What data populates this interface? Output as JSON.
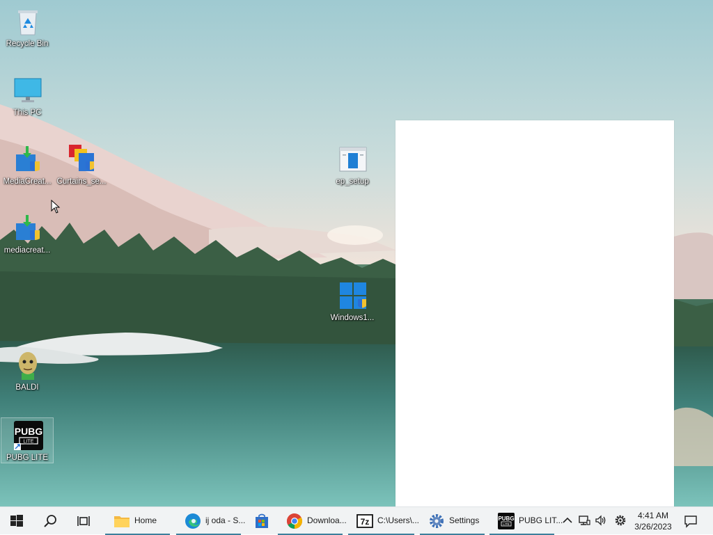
{
  "desktop": {
    "icons": [
      {
        "label": "Recycle Bin",
        "icon": "recycle-bin-icon"
      },
      {
        "label": "This PC",
        "icon": "monitor-icon"
      },
      {
        "label": "MediaCreat...",
        "icon": "media-creation-tool-icon"
      },
      {
        "label": "Curtains_se...",
        "icon": "curtains-setup-icon"
      },
      {
        "label": "ep_setup",
        "icon": "window-app-icon"
      },
      {
        "label": "mediacreat...",
        "icon": "media-creation-tool-icon"
      },
      {
        "label": "Windows1...",
        "icon": "windows-setup-icon"
      },
      {
        "label": "BALDI",
        "icon": "baldi-character-icon"
      },
      {
        "label": "PUBG LITE",
        "icon": "pubg-lite-icon"
      }
    ]
  },
  "taskbar": {
    "apps": [
      {
        "label": "Home",
        "icon": "file-explorer-icon"
      },
      {
        "label": "ij oda - S...",
        "icon": "edge-icon"
      },
      {
        "label": "",
        "icon": "store-icon"
      },
      {
        "label": "Downloa...",
        "icon": "chrome-icon"
      },
      {
        "label": "C:\\Users\\...",
        "icon": "7zip-icon"
      },
      {
        "label": "Settings",
        "icon": "gear-icon"
      },
      {
        "label": "PUBG LIT...",
        "icon": "pubg-lite-icon"
      }
    ],
    "clock": {
      "time": "4:41 AM",
      "date": "3/26/2023"
    }
  },
  "colors": {
    "taskbar_bg": "#f1f3f4",
    "running_indicator": "#3c7f9c",
    "window_bg": "#ffffff"
  }
}
